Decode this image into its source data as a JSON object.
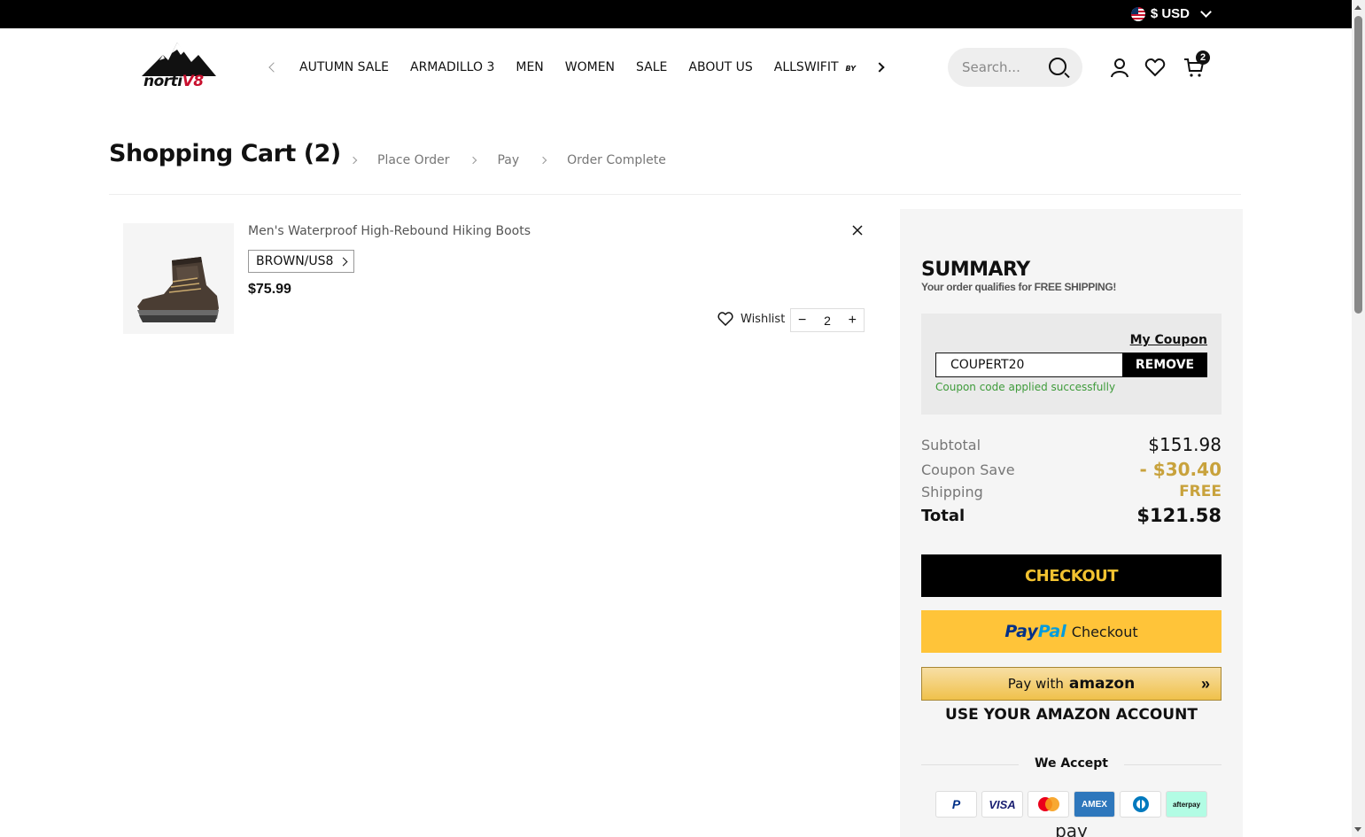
{
  "topbar": {
    "currency": "$ USD"
  },
  "header": {
    "logo_text": "nortiV8",
    "nav": [
      "AUTUMN SALE",
      "ARMADILLO 3",
      "MEN",
      "WOMEN",
      "SALE",
      "ABOUT US",
      "ALLSWIFIT"
    ],
    "nav_by_tag": "BY",
    "search_placeholder": "Search...",
    "cart_count": "2"
  },
  "page": {
    "title": "Shopping Cart (2)",
    "steps": [
      "Place Order",
      "Pay",
      "Order Complete"
    ]
  },
  "cart_item": {
    "name": "Men's Waterproof High-Rebound Hiking Boots",
    "variant": "BROWN/US8",
    "price": "$75.99",
    "wishlist_label": "Wishlist",
    "quantity": "2"
  },
  "summary": {
    "title": "SUMMARY",
    "note": "Your order qualifies for FREE SHIPPING!",
    "my_coupon": "My Coupon",
    "coupon_code": "COUPERT20",
    "remove_label": "REMOVE",
    "coupon_message": "Coupon code applied successfully",
    "subtotal_label": "Subtotal",
    "subtotal": "$151.98",
    "coupon_save_label": "Coupon Save",
    "coupon_save": "- $30.40",
    "shipping_label": "Shipping",
    "shipping": "FREE",
    "total_label": "Total",
    "total": "$121.58",
    "checkout_label": "CHECKOUT",
    "paypal_pay": "Pay",
    "paypal_pal": "Pal",
    "paypal_text": "Checkout",
    "amazon_text": "Pay with",
    "amazon_brand": "amazon",
    "amazon_sub": "USE YOUR AMAZON ACCOUNT",
    "we_accept": "We Accept",
    "cards": [
      "P",
      "VISA",
      "",
      "AMEX",
      "",
      "afterpay"
    ],
    "pay_more": "pay"
  },
  "colors": {
    "gold": "#c8a23c",
    "checkout_text": "#f2c230",
    "paypal_bg": "#ffc439",
    "success": "#3e9b3a"
  }
}
